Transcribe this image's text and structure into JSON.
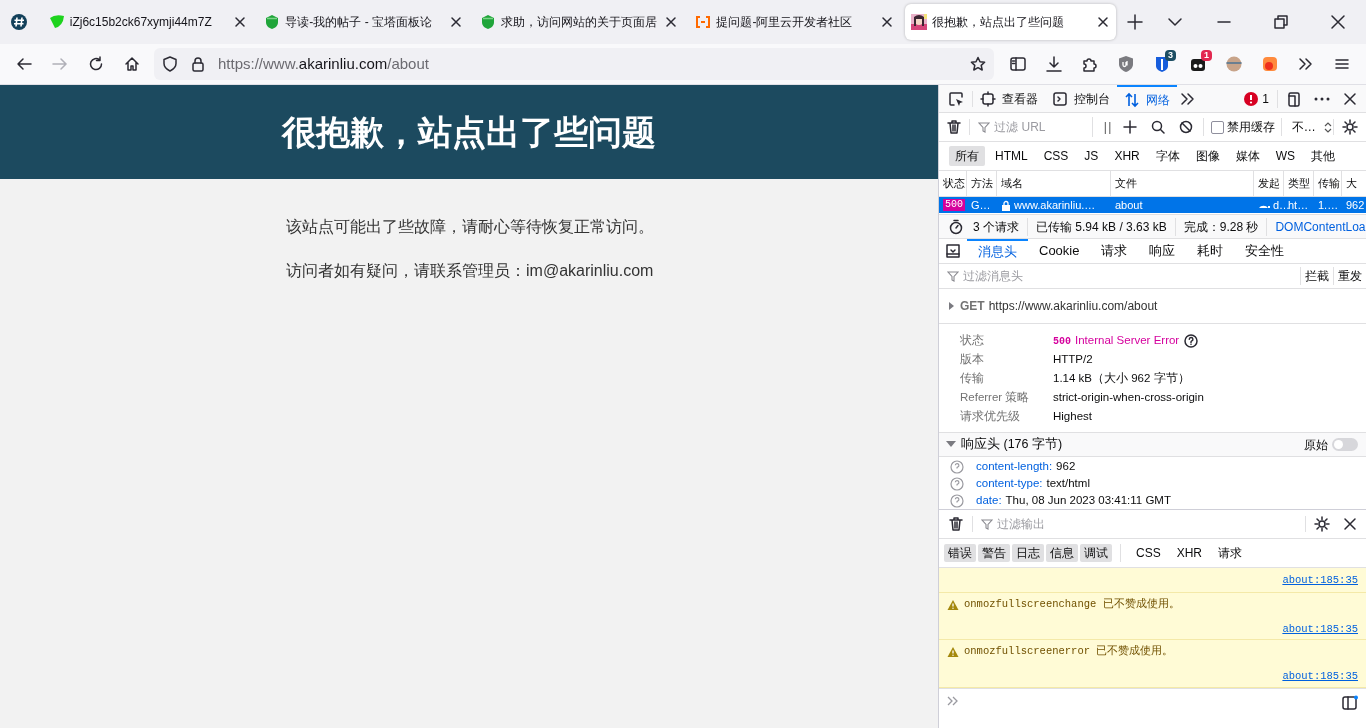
{
  "browser": {
    "tabs": [
      {
        "kind": "leaf",
        "title": "iZj6c15b2ck67xymji44m7Z",
        "selected": false
      },
      {
        "kind": "shield",
        "title": "导读-我的帖子 - 宝塔面板论",
        "selected": false
      },
      {
        "kind": "shield",
        "title": "求助，访问网站的关于页面居",
        "selected": false
      },
      {
        "kind": "bracket",
        "title": "提问题-阿里云开发者社区",
        "selected": false
      },
      {
        "kind": "picture",
        "title": "很抱歉，站点出了些问题",
        "selected": true
      }
    ],
    "url": {
      "prefix": "https://www.",
      "host": "akarinliu.com",
      "path": "/about"
    },
    "badges": [
      "3",
      "1"
    ]
  },
  "page": {
    "heading": "很抱歉，站点出了些问题",
    "paragraphs": [
      "该站点可能出了些故障，请耐心等待恢复正常访问。",
      "访问者如有疑问，请联系管理员：im@akarinliu.com"
    ]
  },
  "devtools": {
    "tools": [
      {
        "kind": "inspector",
        "label": "查看器",
        "selected": false
      },
      {
        "kind": "console",
        "label": "控制台",
        "selected": false
      },
      {
        "kind": "network",
        "label": "网络",
        "selected": true
      }
    ],
    "error_count": "1",
    "url_filter": {
      "placeholder": "过滤 URL"
    },
    "pause": "| |",
    "disable_cache": {
      "label": "禁用缓存",
      "checked": false
    },
    "throttle": "不…",
    "type_filters": [
      {
        "label": "所有",
        "selected": true
      },
      {
        "label": "HTML",
        "selected": false
      },
      {
        "label": "CSS",
        "selected": false
      },
      {
        "label": "JS",
        "selected": false
      },
      {
        "label": "XHR",
        "selected": false
      },
      {
        "label": "字体",
        "selected": false
      },
      {
        "label": "图像",
        "selected": false
      },
      {
        "label": "媒体",
        "selected": false
      },
      {
        "label": "WS",
        "selected": false
      },
      {
        "label": "其他",
        "selected": false
      }
    ],
    "columns": [
      "状态",
      "方法",
      "域名",
      "文件",
      "发起",
      "类型",
      "传输",
      "大"
    ],
    "rows": [
      {
        "status": "500",
        "method": "G…",
        "domain": "www.akarinliu.…",
        "file": "about",
        "initiator": "d…",
        "type": "ht…",
        "transferred": "1.…",
        "size": "962",
        "selected": true
      }
    ],
    "summary": {
      "requests": "3 个请求",
      "transferred": "已传输 5.94 kB / 3.63 kB",
      "finish": "完成：9.28 秒",
      "dom": "DOMContentLoa"
    },
    "detail_tabs": [
      {
        "label": "消息头",
        "selected": true
      },
      {
        "label": "Cookie",
        "selected": false
      },
      {
        "label": "请求",
        "selected": false
      },
      {
        "label": "响应",
        "selected": false
      },
      {
        "label": "耗时",
        "selected": false
      },
      {
        "label": "安全性",
        "selected": false
      }
    ],
    "headers_filter": {
      "placeholder": "过滤消息头"
    },
    "block": "拦截",
    "resend": "重发",
    "request_line": {
      "method": "GET",
      "url": "https://www.akarinliu.com/about"
    },
    "general": [
      {
        "kind": "status",
        "label": "状态",
        "code": "500",
        "value": "Internal Server Error"
      },
      {
        "kind": "plain",
        "label": "版本",
        "value": "HTTP/2"
      },
      {
        "kind": "plain",
        "label": "传输",
        "value": "1.14 kB（大小 962 字节）"
      },
      {
        "kind": "plain",
        "label": "Referrer 策略",
        "value": "strict-origin-when-cross-origin"
      },
      {
        "kind": "plain",
        "label": "请求优先级",
        "value": "Highest"
      }
    ],
    "response_headers": {
      "title": "响应头 (176 字节)",
      "expanded": true,
      "raw_label": "原始",
      "raw_on": false,
      "items": [
        {
          "name": "content-length:",
          "value": "962"
        },
        {
          "name": "content-type:",
          "value": "text/html"
        },
        {
          "name": "date:",
          "value": "Thu, 08 Jun 2023 03:41:11 GMT"
        }
      ]
    },
    "console": {
      "filter": {
        "placeholder": "过滤输出"
      },
      "levels": [
        {
          "label": "错误",
          "selected": true
        },
        {
          "label": "警告",
          "selected": true
        },
        {
          "label": "日志",
          "selected": true
        },
        {
          "label": "信息",
          "selected": true
        },
        {
          "label": "调试",
          "selected": true
        }
      ],
      "categories": [
        {
          "label": "CSS",
          "selected": false
        },
        {
          "label": "XHR",
          "selected": false
        },
        {
          "label": "请求",
          "selected": false
        }
      ],
      "messages": [
        {
          "kind": "tail",
          "location": "about:185:35"
        },
        {
          "kind": "warning",
          "text": "onmozfullscreenchange 已不赞成使用。",
          "location": "about:185:35"
        },
        {
          "kind": "warning",
          "text": "onmozfullscreenerror 已不赞成使用。",
          "location": "about:185:35"
        }
      ]
    }
  }
}
